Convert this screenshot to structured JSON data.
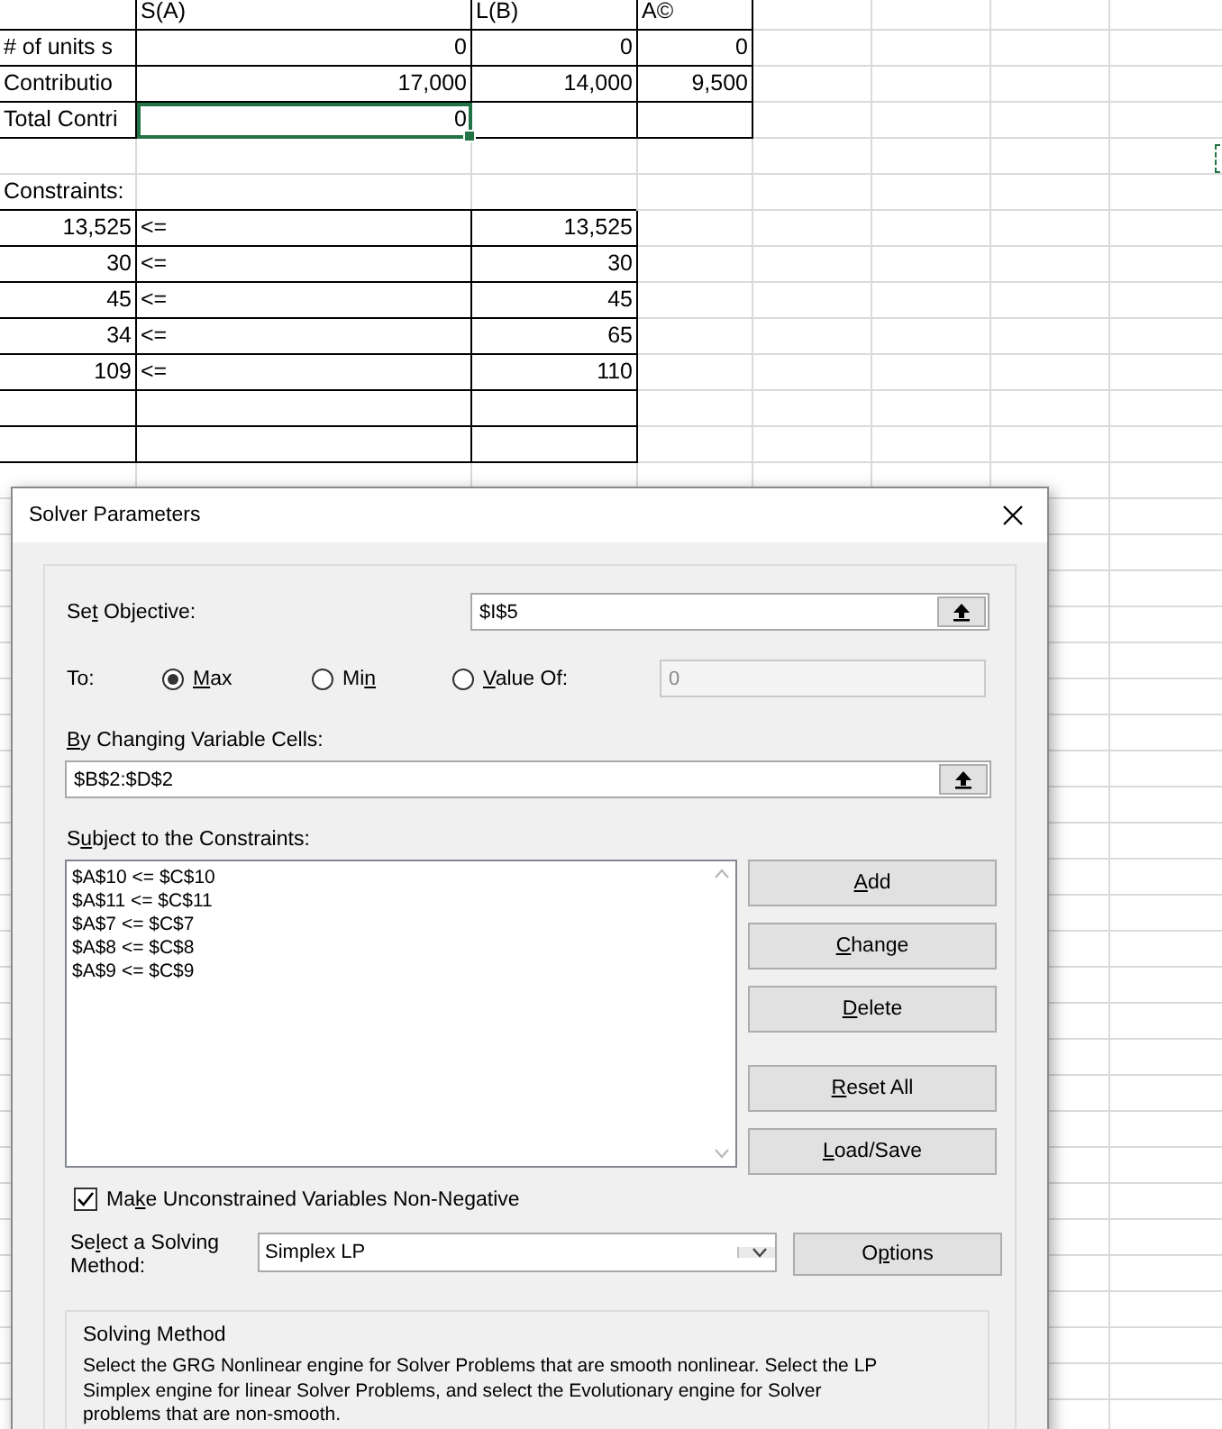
{
  "sheet": {
    "columns": [
      "S(A)",
      "L(B)",
      "A©"
    ],
    "rows": [
      {
        "label": "# of units s",
        "cells": [
          {
            "text": "0",
            "selected": false
          },
          {
            "text": "0",
            "selected": false
          },
          {
            "text": "0",
            "selected": false
          }
        ]
      },
      {
        "label": "Contributio",
        "cells": [
          {
            "text": "17,000",
            "selected": false
          },
          {
            "text": "14,000",
            "selected": false
          },
          {
            "text": "9,500",
            "selected": false
          }
        ]
      },
      {
        "label": "Total Contri",
        "cells": [
          {
            "text": "0",
            "selected": true
          }
        ]
      }
    ],
    "constraints_label": "Constraints:",
    "constraints": [
      {
        "lhs": "13,525",
        "op": "<=",
        "rhs": "13,525"
      },
      {
        "lhs": "30",
        "op": "<=",
        "rhs": "30"
      },
      {
        "lhs": "45",
        "op": "<=",
        "rhs": "45"
      },
      {
        "lhs": "34",
        "op": "<=",
        "rhs": "65"
      },
      {
        "lhs": "109",
        "op": "<=",
        "rhs": "110"
      }
    ]
  },
  "dialog": {
    "title": "Solver Parameters",
    "objective": {
      "label": [
        {
          "text": "Se",
          "underlined": false
        },
        {
          "text": "t",
          "underlined": true
        },
        {
          "text": " Objective:",
          "underlined": false
        }
      ],
      "value": "$I$5"
    },
    "to": {
      "label": "To:",
      "options": [
        {
          "label": [
            {
              "text": "M",
              "underlined": true
            },
            {
              "text": "ax",
              "underlined": false
            }
          ],
          "selected": true
        },
        {
          "label": [
            {
              "text": "Mi",
              "underlined": false
            },
            {
              "text": "n",
              "underlined": true
            }
          ],
          "selected": false
        },
        {
          "label": [
            {
              "text": "V",
              "underlined": true
            },
            {
              "text": "alue Of:",
              "underlined": false
            }
          ],
          "selected": false
        }
      ],
      "value_of": {
        "value": "0",
        "disabled": true
      }
    },
    "changing": {
      "label": [
        {
          "text": "B",
          "underlined": true
        },
        {
          "text": "y Changing Variable Cells:",
          "underlined": false
        }
      ],
      "value": "$B$2:$D$2"
    },
    "constraints": {
      "label": [
        {
          "text": "S",
          "underlined": false
        },
        {
          "text": "u",
          "underlined": true
        },
        {
          "text": "bject to the Constraints:",
          "underlined": false
        }
      ],
      "items": [
        "$A$10 <= $C$10",
        "$A$11 <= $C$11",
        "$A$7 <= $C$7",
        "$A$8 <= $C$8",
        "$A$9 <= $C$9"
      ]
    },
    "buttons": [
      [
        {
          "text": "A",
          "underlined": true
        },
        {
          "text": "dd",
          "underlined": false
        }
      ],
      [
        {
          "text": "C",
          "underlined": true
        },
        {
          "text": "hange",
          "underlined": false
        }
      ],
      [
        {
          "text": "D",
          "underlined": true
        },
        {
          "text": "elete",
          "underlined": false
        }
      ],
      [
        {
          "text": "R",
          "underlined": true
        },
        {
          "text": "eset All",
          "underlined": false
        }
      ],
      [
        {
          "text": "L",
          "underlined": true
        },
        {
          "text": "oad/Save",
          "underlined": false
        }
      ]
    ],
    "non_negative": {
      "label": [
        {
          "text": "Ma",
          "underlined": false
        },
        {
          "text": "k",
          "underlined": true
        },
        {
          "text": "e Unconstrained Variables Non-Negative",
          "underlined": false
        }
      ],
      "checked": true
    },
    "method": {
      "label": [
        {
          "text": "Se",
          "underlined": false
        },
        {
          "text": "l",
          "underlined": true
        },
        {
          "text": "ect a Solving Method:",
          "underlined": false
        }
      ],
      "value": "Simplex LP"
    },
    "options_button": [
      {
        "text": "O",
        "underlined": false
      },
      {
        "text": "p",
        "underlined": true
      },
      {
        "text": "tions",
        "underlined": false
      }
    ],
    "solving_method": {
      "title": "Solving Method",
      "description": "Select the GRG Nonlinear engine for Solver Problems that are smooth nonlinear. Select the LP Simplex engine for linear Solver Problems, and select the Evolutionary engine for Solver problems that are non-smooth."
    }
  }
}
